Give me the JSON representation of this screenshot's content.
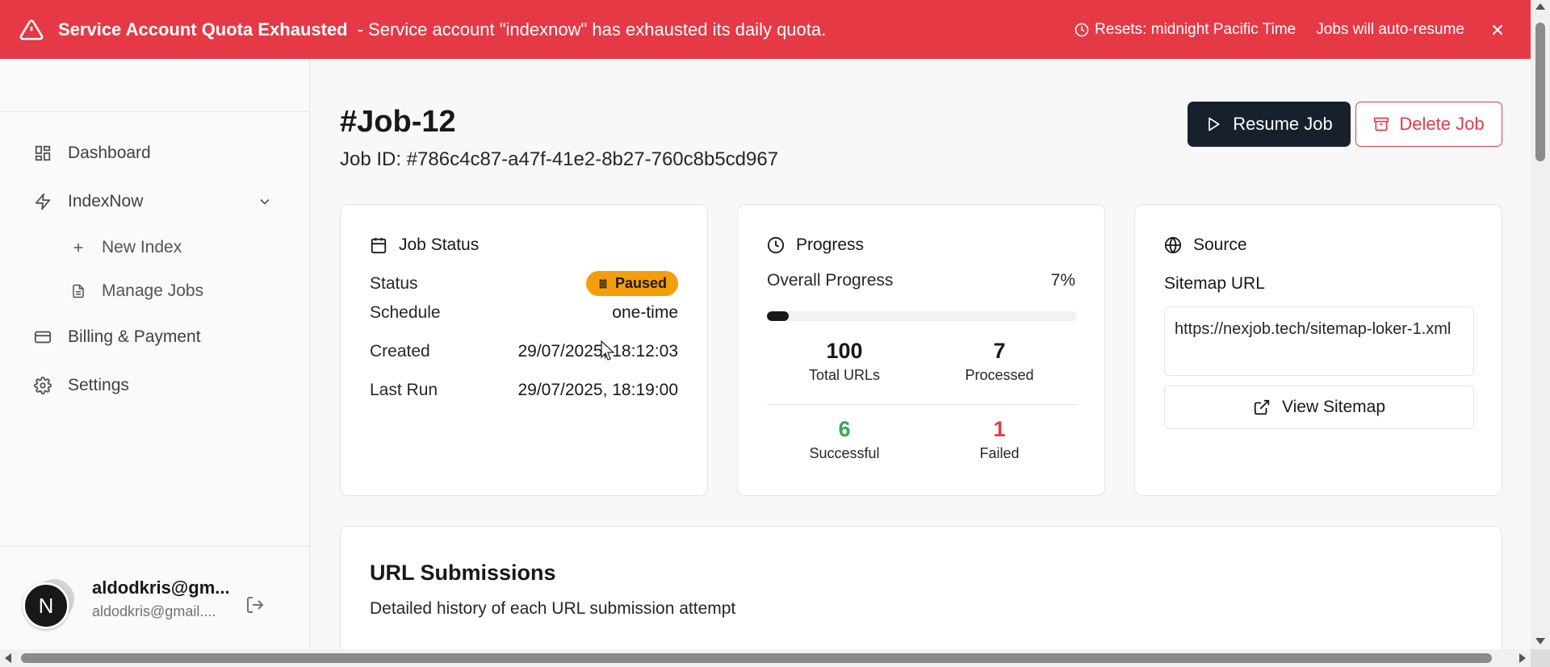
{
  "banner": {
    "title": "Service Account Quota Exhausted",
    "message": "- Service account \"indexnow\" has exhausted its daily quota.",
    "reset": "Resets: midnight Pacific Time",
    "auto_resume": "Jobs will auto-resume",
    "color": "#e63946"
  },
  "sidebar": {
    "brand": "IndexNow",
    "nav": {
      "dashboard": "Dashboard",
      "indexnow": "IndexNow",
      "new_index": "New Index",
      "manage_jobs": "Manage Jobs",
      "billing": "Billing & Payment",
      "settings": "Settings"
    },
    "user": {
      "initial": "N",
      "name": "aldodkris@gm...",
      "email": "aldodkris@gmail...."
    }
  },
  "header": {
    "title": "#Job-12",
    "job_id": "Job ID: #786c4c87-a47f-41e2-8b27-760c8b5cd967",
    "resume_label": "Resume Job",
    "delete_label": "Delete Job"
  },
  "job_status": {
    "heading": "Job Status",
    "status_label": "Status",
    "status_value": "Paused",
    "schedule_label": "Schedule",
    "schedule_value": "one-time",
    "created_label": "Created",
    "created_value": "29/07/2025, 18:12:03",
    "last_run_label": "Last Run",
    "last_run_value": "29/07/2025, 18:19:00"
  },
  "progress": {
    "heading": "Progress",
    "overall_label": "Overall Progress",
    "percent_text": "7%",
    "percent": 7,
    "total_urls": "100",
    "total_label": "Total URLs",
    "processed": "7",
    "processed_label": "Processed",
    "successful": "6",
    "successful_label": "Successful",
    "failed": "1",
    "failed_label": "Failed",
    "success_color": "#3aa655",
    "failed_color": "#e63946"
  },
  "source": {
    "heading": "Source",
    "sitemap_label": "Sitemap URL",
    "sitemap_url": "https://nexjob.tech/sitemap-loker-1.xml",
    "view_label": "View Sitemap"
  },
  "submissions": {
    "title": "URL Submissions",
    "description": "Detailed history of each URL submission attempt"
  }
}
